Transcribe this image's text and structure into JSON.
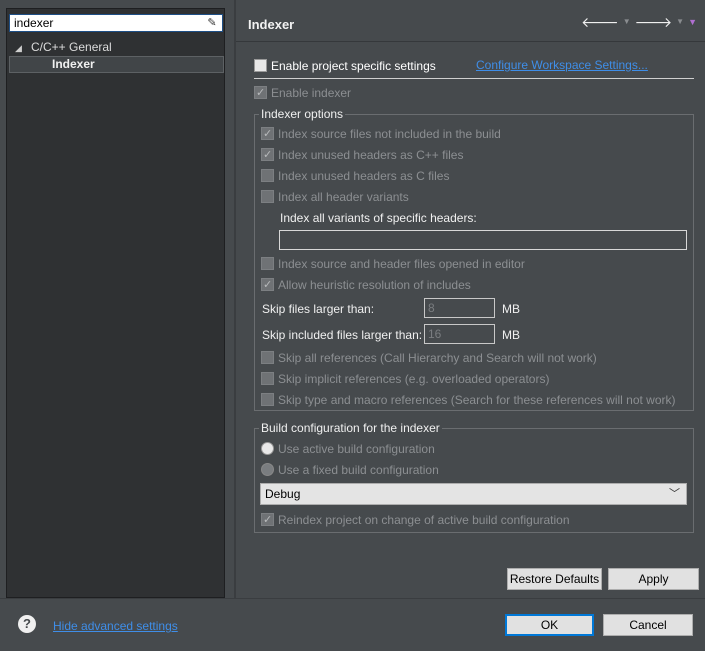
{
  "filter": {
    "value": "indexer",
    "clear_icon": "eraser-icon"
  },
  "tree": {
    "parent": {
      "label": "C/C++ General",
      "expanded": true
    },
    "child": {
      "label": "Indexer",
      "selected": true
    }
  },
  "header": {
    "title": "Indexer",
    "nav_icons": [
      "back-arrow-icon",
      "dropdown-icon",
      "forward-arrow-icon",
      "dropdown-icon",
      "view-menu-icon"
    ]
  },
  "project_settings": {
    "enable_label": "Enable project specific settings",
    "enable_checked": false,
    "configure_link": "Configure Workspace Settings..."
  },
  "enable_indexer": {
    "label": "Enable indexer",
    "checked": true,
    "enabled": false
  },
  "indexer_options": {
    "title": "Indexer options",
    "items": [
      {
        "label": "Index source files not included in the build",
        "checked": true
      },
      {
        "label": "Index unused headers as C++ files",
        "checked": true
      },
      {
        "label": "Index unused headers as C files",
        "checked": false
      },
      {
        "label": "Index all header variants",
        "checked": false
      }
    ],
    "specific_headers_label": "Index all variants of specific headers:",
    "specific_headers_value": "",
    "items2": [
      {
        "label": "Index source and header files opened in editor",
        "checked": false
      },
      {
        "label": "Allow heuristic resolution of includes",
        "checked": true
      }
    ],
    "skip_files_label": "Skip files larger than:",
    "skip_files_value": "8",
    "skip_included_label": "Skip included files larger than:",
    "skip_included_value": "16",
    "unit": "MB",
    "items3": [
      {
        "label": "Skip all references (Call Hierarchy and Search will not work)",
        "checked": false
      },
      {
        "label": "Skip implicit references (e.g. overloaded operators)",
        "checked": false
      },
      {
        "label": "Skip type and macro references (Search for these references will not work)",
        "checked": false
      }
    ]
  },
  "build_config": {
    "title": "Build configuration for the indexer",
    "radio_active": "Use active build configuration",
    "radio_fixed": "Use a fixed build configuration",
    "selected_config": "Debug",
    "reindex_label": "Reindex project on change of active build configuration",
    "reindex_checked": true
  },
  "buttons": {
    "restore_defaults": "Restore Defaults",
    "apply": "Apply",
    "ok": "OK",
    "cancel": "Cancel"
  },
  "footer": {
    "help_icon": "help-icon",
    "advanced_link": "Hide advanced settings"
  },
  "colors": {
    "background": "#464a4d",
    "left_pane": "#2f3133",
    "link": "#3f8ee8",
    "accent": "#0078d7"
  }
}
